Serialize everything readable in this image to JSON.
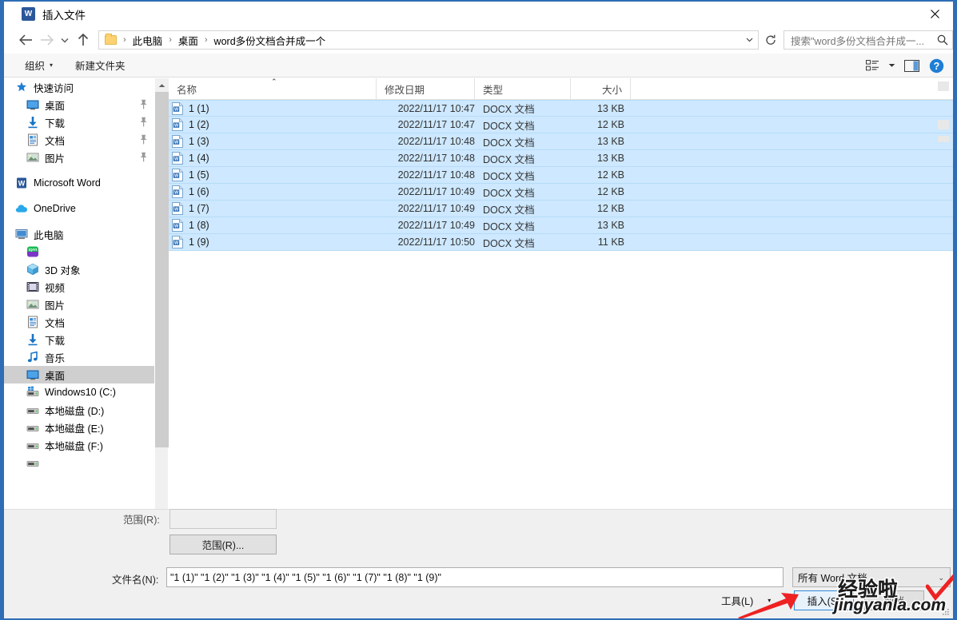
{
  "window": {
    "title": "插入文件",
    "app_icon": "word-icon",
    "close_label": "✕"
  },
  "nav": {
    "back_icon": "back-arrow-icon",
    "forward_icon": "forward-arrow-icon",
    "recent_icon": "chevron-down-icon",
    "up_icon": "up-arrow-icon",
    "refresh_icon": "refresh-icon",
    "breadcrumb": [
      "此电脑",
      "桌面",
      "word多份文档合并成一个"
    ],
    "separator": "›"
  },
  "search": {
    "placeholder": "搜索\"word多份文档合并成一...",
    "icon": "search-icon"
  },
  "toolbar": {
    "organize_label": "组织",
    "new_folder_label": "新建文件夹",
    "view_icon": "view-list-icon",
    "pane_icon": "preview-pane-icon",
    "help_icon": "help-icon",
    "caret": "▾"
  },
  "sidebar": {
    "groups": [
      {
        "header": {
          "label": "快速访问",
          "icon": "pin-star-icon",
          "indent": 14
        },
        "items": [
          {
            "label": "桌面",
            "icon": "desktop-icon",
            "pinned": true,
            "indent": 28
          },
          {
            "label": "下载",
            "icon": "download-icon",
            "pinned": true,
            "indent": 28
          },
          {
            "label": "文档",
            "icon": "documents-icon",
            "pinned": true,
            "indent": 28
          },
          {
            "label": "图片",
            "icon": "pictures-icon",
            "pinned": true,
            "indent": 28
          }
        ]
      },
      {
        "header": {
          "label": "Microsoft Word",
          "icon": "word-icon",
          "indent": 14
        },
        "items": []
      },
      {
        "header": {
          "label": "OneDrive",
          "icon": "onedrive-icon",
          "indent": 14
        },
        "items": []
      },
      {
        "header": {
          "label": "此电脑",
          "icon": "this-pc-icon",
          "indent": 14
        },
        "items": [
          {
            "label": "",
            "icon": "iqiyi-icon",
            "pinned": false,
            "indent": 28
          },
          {
            "label": "3D 对象",
            "icon": "3d-objects-icon",
            "pinned": false,
            "indent": 28
          },
          {
            "label": "视频",
            "icon": "videos-icon",
            "pinned": false,
            "indent": 28
          },
          {
            "label": "图片",
            "icon": "pictures-icon",
            "pinned": false,
            "indent": 28
          },
          {
            "label": "文档",
            "icon": "documents-icon",
            "pinned": false,
            "indent": 28
          },
          {
            "label": "下载",
            "icon": "download-icon",
            "pinned": false,
            "indent": 28
          },
          {
            "label": "音乐",
            "icon": "music-icon",
            "pinned": false,
            "indent": 28
          },
          {
            "label": "桌面",
            "icon": "desktop-icon",
            "pinned": false,
            "indent": 28,
            "selected": true
          },
          {
            "label": "Windows10 (C:)",
            "icon": "windows-drive-icon",
            "pinned": false,
            "indent": 28
          },
          {
            "label": "本地磁盘 (D:)",
            "icon": "drive-icon",
            "pinned": false,
            "indent": 28
          },
          {
            "label": "本地磁盘 (E:)",
            "icon": "drive-icon",
            "pinned": false,
            "indent": 28
          },
          {
            "label": "本地磁盘 (F:)",
            "icon": "drive-icon",
            "pinned": false,
            "indent": 28
          }
        ]
      }
    ]
  },
  "filelist": {
    "columns": [
      "名称",
      "修改日期",
      "类型",
      "大小"
    ],
    "sort_indicator": "⌃",
    "rows": [
      {
        "name": "1 (1)",
        "date": "2022/11/17 10:47",
        "type": "DOCX 文档",
        "size": "13 KB",
        "selected": true
      },
      {
        "name": "1 (2)",
        "date": "2022/11/17 10:47",
        "type": "DOCX 文档",
        "size": "12 KB",
        "selected": true
      },
      {
        "name": "1 (3)",
        "date": "2022/11/17 10:48",
        "type": "DOCX 文档",
        "size": "13 KB",
        "selected": true
      },
      {
        "name": "1 (4)",
        "date": "2022/11/17 10:48",
        "type": "DOCX 文档",
        "size": "13 KB",
        "selected": true
      },
      {
        "name": "1 (5)",
        "date": "2022/11/17 10:48",
        "type": "DOCX 文档",
        "size": "12 KB",
        "selected": true
      },
      {
        "name": "1 (6)",
        "date": "2022/11/17 10:49",
        "type": "DOCX 文档",
        "size": "12 KB",
        "selected": true
      },
      {
        "name": "1 (7)",
        "date": "2022/11/17 10:49",
        "type": "DOCX 文档",
        "size": "12 KB",
        "selected": true
      },
      {
        "name": "1 (8)",
        "date": "2022/11/17 10:49",
        "type": "DOCX 文档",
        "size": "13 KB",
        "selected": true
      },
      {
        "name": "1 (9)",
        "date": "2022/11/17 10:50",
        "type": "DOCX 文档",
        "size": "11 KB",
        "selected": true
      }
    ]
  },
  "form": {
    "range_label": "范围(R):",
    "range_value": "",
    "range_button": "范围(R)...",
    "filename_label": "文件名(N):",
    "filename_value": "\"1 (1)\" \"1 (2)\" \"1 (3)\" \"1 (4)\" \"1 (5)\" \"1 (6)\" \"1 (7)\" \"1 (8)\" \"1 (9)\"",
    "filetype_value": "所有 Word 文档",
    "filetype_caret": "⌄",
    "tools_label": "工具(L)",
    "tools_caret": "▾",
    "insert_button": "插入(S)",
    "cancel_button": "取消"
  },
  "annotation": {
    "arrow": "red-arrow-pointing-to-insert",
    "watermark_cn": "经验啦",
    "watermark_en": "jingyanla.com",
    "check_mark": "red-check-mark"
  },
  "colors": {
    "window_border": "#2f6db5",
    "selection": "#cde8ff",
    "sidebar_selection": "#cfcfcf",
    "accent_blue": "#2b579a",
    "annotation_red": "#ee2222",
    "chrome_gray": "#f0f0f0"
  }
}
